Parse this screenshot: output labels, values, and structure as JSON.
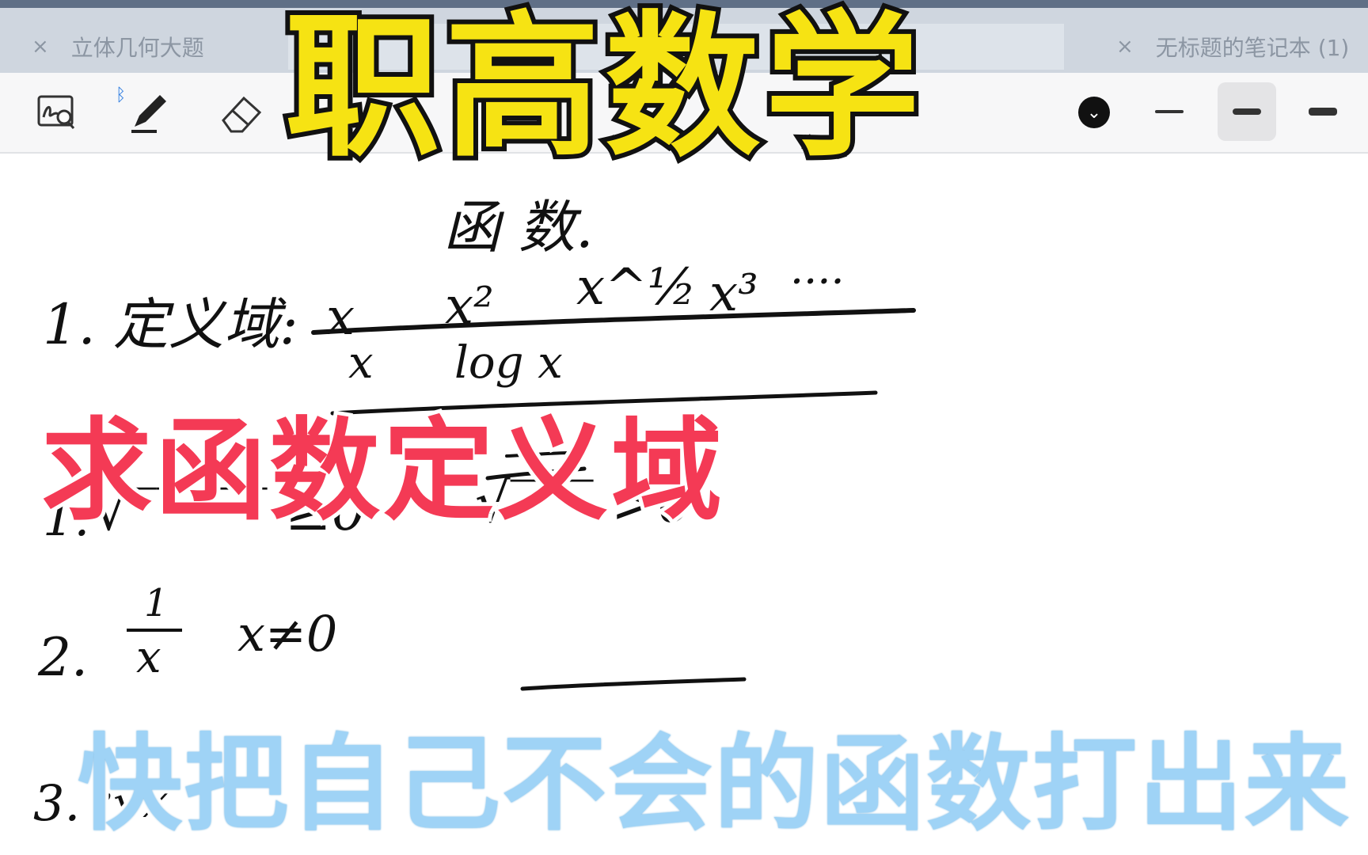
{
  "tabs": [
    {
      "close": "×",
      "label": "立体几何大题"
    },
    {
      "close": "×",
      "label": "无标题的笔记本 (1)"
    }
  ],
  "toolbar": {
    "tools": [
      "lasso-zoom-icon",
      "pen-icon",
      "eraser-icon"
    ],
    "bluetooth": "ᛒ",
    "chevron": "⌄",
    "colors": {
      "accent": "#2f7de1",
      "toolbar_bg": "#f7f7f8",
      "tabbar_bg": "#cfd6df"
    }
  },
  "overlay": {
    "title": "职高数学",
    "subtitle": "求函数定义域",
    "caption": "快把自己不会的函数打出来"
  },
  "notes": {
    "heading": "函 数.",
    "line1_label": "1. 定义域:",
    "line1_terms": [
      "x",
      "x²",
      "x^½",
      "x³",
      "····"
    ],
    "line2_terms": [
      "x",
      "log x"
    ],
    "rule1_label": "1.",
    "rule1_a": "√‾‾‾‾‾   ≥0",
    "rule1_b": "√‾‾‾   >0",
    "rule2_label": "2.",
    "rule2_frac_num": "1",
    "rule2_frac_den": "x",
    "rule2_cond": "x≠0",
    "rule3_label": "3.",
    "rule3_expr": "³√x"
  }
}
